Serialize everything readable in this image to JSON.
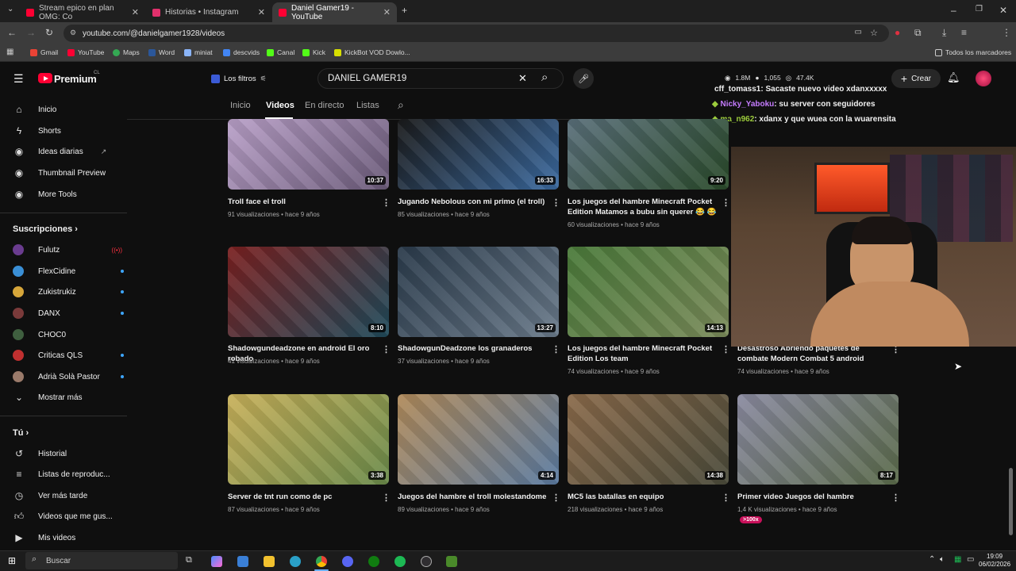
{
  "browser": {
    "tabs": [
      {
        "title": "Stream epico en plan OMG: Co",
        "color": "#ff0033",
        "active": false
      },
      {
        "title": "Historias • Instagram",
        "color": "#e1306c",
        "active": false
      },
      {
        "title": "Daniel Gamer19 - YouTube",
        "color": "#ff0033",
        "active": true
      }
    ],
    "url": "youtube.com/@danielgamer1928/videos",
    "bookmarks": [
      "Gmail",
      "YouTube",
      "Maps",
      "Word",
      "miniat",
      "descvids",
      "Canal",
      "Kick",
      "KickBot VOD Dowlo..."
    ],
    "all_bookmarks": "Todos los marcadores"
  },
  "youtube": {
    "logo_text": "Premium",
    "logo_country": "CL",
    "filter_label": "Los filtros",
    "search_value": "DANIEL GAMER19",
    "create_label": "Crear",
    "stats": {
      "viewers": "1.8M",
      "a": "1,055",
      "b": "47.4K"
    }
  },
  "sidebar": {
    "main": [
      "Inicio",
      "Shorts",
      "Ideas diarias",
      "Thumbnail Preview",
      "More Tools"
    ],
    "subs_header": "Suscripciones",
    "subs": [
      {
        "name": "Fulutz",
        "color": "#6a3c8f"
      },
      {
        "name": "FlexCidine",
        "color": "#3a8fd6"
      },
      {
        "name": "Zukistrukiz",
        "color": "#d6a63a"
      },
      {
        "name": "DANX",
        "color": "#7a3a3a"
      },
      {
        "name": "CHOC0",
        "color": "#3f5f3f"
      },
      {
        "name": "Criticas QLS",
        "color": "#c03030"
      },
      {
        "name": "Adrià Solà Pastor",
        "color": "#9a7a6a"
      }
    ],
    "show_more": "Mostrar más",
    "you_header": "Tú",
    "you": [
      "Historial",
      "Listas de reproduc...",
      "Ver más tarde",
      "Videos que me gus...",
      "Mis videos"
    ]
  },
  "channel_tabs": [
    "Inicio",
    "Videos",
    "En directo",
    "Listas"
  ],
  "videos": [
    {
      "title": "Troll face el troll",
      "meta": "91 visualizaciones • hace 9 años",
      "duration": "10:37",
      "c1": "#b9a0c8",
      "c2": "#6a5a78"
    },
    {
      "title": "Jugando Nebolous con mi primo (el troll)",
      "meta": "85 visualizaciones • hace 9 años",
      "duration": "16:33",
      "c1": "#1a1a1a",
      "c2": "#3b6aa0"
    },
    {
      "title": "Los juegos del hambre Minecraft Pocket Edition Matamos a bubu sin querer 😂 😂",
      "meta": "60 visualizaciones • hace 9 años",
      "duration": "9:20",
      "c1": "#5a6f7a",
      "c2": "#2a4a2a"
    },
    {
      "title": "Shadowgundeadzone en android El oro robado",
      "meta": "41 visualizaciones • hace 9 años",
      "duration": "8:10",
      "c1": "#7a2020",
      "c2": "#1f4a5a"
    },
    {
      "title": "ShadowgunDeadzone los granaderos",
      "meta": "37 visualizaciones • hace 9 años",
      "duration": "13:27",
      "c1": "#2a3a4a",
      "c2": "#6a7a8a"
    },
    {
      "title": "Los juegos del hambre Minecraft Pocket Edition Los team",
      "meta": "74 visualizaciones • hace 9 años",
      "duration": "14:13",
      "c1": "#4a7a3a",
      "c2": "#7a8a5a"
    },
    {
      "title": "Desastroso Abriendo paquetes de combate Modern Combat 5 android",
      "meta": "74 visualizaciones • hace 9 años",
      "duration": "",
      "c1": "#3a3a3a",
      "c2": "#5a5a5a"
    },
    {
      "title": "Server de tnt run como de pc",
      "meta": "87 visualizaciones • hace 9 años",
      "duration": "3:38",
      "c1": "#c8b05a",
      "c2": "#6a8a4a"
    },
    {
      "title": "Juegos del hambre el troll molestandome",
      "meta": "89 visualizaciones • hace 9 años",
      "duration": "4:14",
      "c1": "#b08a5a",
      "c2": "#5a7aa0"
    },
    {
      "title": "MC5 las batallas en equipo",
      "meta": "218 visualizaciones • hace 9 años",
      "duration": "14:38",
      "c1": "#8a6a4a",
      "c2": "#4a4a3a"
    },
    {
      "title": "Primer video Juegos del hambre",
      "meta": "1,4 K visualizaciones • hace 9 años",
      "duration": "8:17",
      "c1": "#8a8aa0",
      "c2": "#5a6a4a",
      "badge": ">100x"
    }
  ],
  "chat": [
    {
      "user": "cff_tomass1",
      "msg": ": Sacaste nuevo video xdanxxxxx",
      "color": "#f1f1f1"
    },
    {
      "user": "Nicky_Yaboku",
      "msg": ": su server con seguidores",
      "color": "#c57cff"
    },
    {
      "user": "ma_n962",
      "msg": ": xdanx y que wuea con la wuarensita",
      "color": "#9ccc3c"
    }
  ],
  "taskbar": {
    "search_label": "Buscar",
    "time": "19:09",
    "date": "06/02/2026"
  }
}
